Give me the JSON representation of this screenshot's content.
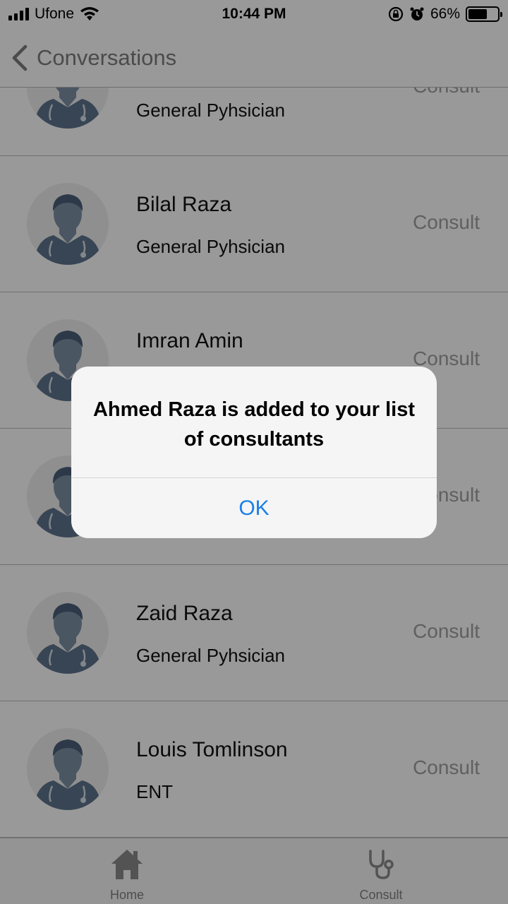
{
  "status_bar": {
    "carrier": "Ufone",
    "time": "10:44 PM",
    "battery": "66%",
    "battery_level": 0.66,
    "icons": [
      "signal-icon",
      "wifi-icon",
      "rotation-lock-icon",
      "alarm-icon",
      "battery-icon"
    ]
  },
  "nav": {
    "back_label": "Conversations"
  },
  "doctors": [
    {
      "name": "",
      "specialty": "General Pyhsician",
      "action": "Consult"
    },
    {
      "name": "Bilal Raza",
      "specialty": "General Pyhsician",
      "action": "Consult"
    },
    {
      "name": "Imran Amin",
      "specialty": "",
      "action": "Consult"
    },
    {
      "name": "",
      "specialty": "",
      "action": "Consult"
    },
    {
      "name": "Zaid Raza",
      "specialty": "General Pyhsician",
      "action": "Consult"
    },
    {
      "name": "Louis Tomlinson",
      "specialty": "ENT",
      "action": "Consult"
    }
  ],
  "tabs": [
    {
      "label": "Home",
      "icon": "home-icon"
    },
    {
      "label": "Consult",
      "icon": "stethoscope-icon"
    }
  ],
  "alert": {
    "message": "Ahmed Raza is added to your list of consultants",
    "ok_label": "OK"
  },
  "colors": {
    "accent": "#1a7fe8",
    "overlay": "rgba(0,0,0,0.4)"
  }
}
